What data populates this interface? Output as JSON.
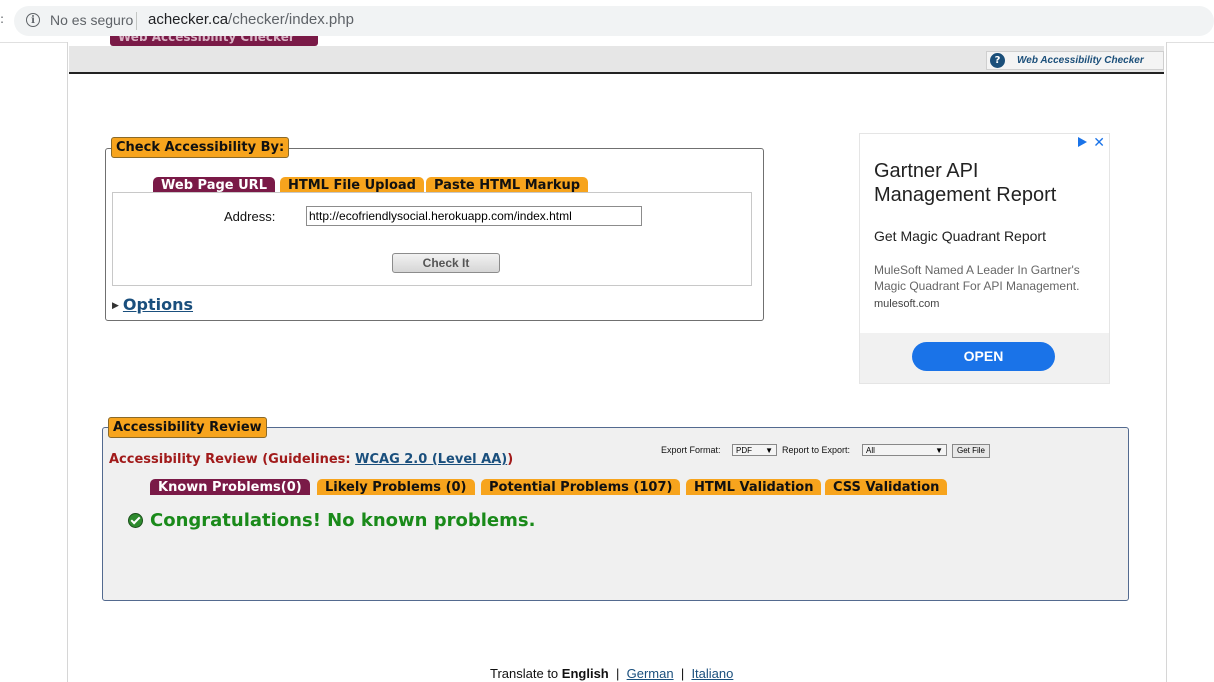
{
  "browser": {
    "not_secure": "No es seguro",
    "url_host": "achecker.ca",
    "url_path": "/checker/index.php"
  },
  "header": {
    "top_tab": "Web Accessibility Checker",
    "help_link": "Web Accessibility Checker"
  },
  "check": {
    "legend": "Check Accessibility By:",
    "tabs": [
      {
        "label": "Web Page URL",
        "active": true
      },
      {
        "label": "HTML File Upload",
        "active": false
      },
      {
        "label": "Paste HTML Markup",
        "active": false
      }
    ],
    "address_label": "Address:",
    "address_value": "http://ecofriendlysocial.herokuapp.com/index.html",
    "check_button": "Check It",
    "options_label": "Options"
  },
  "ad": {
    "title": "Gartner API Management Report",
    "subtitle": "Get Magic Quadrant Report",
    "description": "MuleSoft Named A Leader In Gartner's Magic Quadrant For API Management.",
    "domain": "mulesoft.com",
    "open_button": "OPEN",
    "close": "✕"
  },
  "review": {
    "legend": "Accessibility Review",
    "title_prefix": "Accessibility Review (Guidelines: ",
    "guideline_link": "WCAG 2.0 (Level AA)",
    "title_suffix": ")",
    "export_format_label": "Export Format:",
    "export_format_value": "PDF",
    "report_label": "Report to Export:",
    "report_value": "All",
    "get_file_button": "Get File",
    "tabs": [
      {
        "label": "Known Problems(0)",
        "active": true
      },
      {
        "label": "Likely Problems (0)",
        "active": false
      },
      {
        "label": "Potential Problems (107)",
        "active": false
      },
      {
        "label": "HTML Validation",
        "active": false
      },
      {
        "label": "CSS Validation",
        "active": false
      }
    ],
    "message": "Congratulations! No known problems."
  },
  "footer": {
    "translate_prefix": "Translate to",
    "current_language": "English",
    "languages": [
      "German",
      "Italiano"
    ]
  }
}
